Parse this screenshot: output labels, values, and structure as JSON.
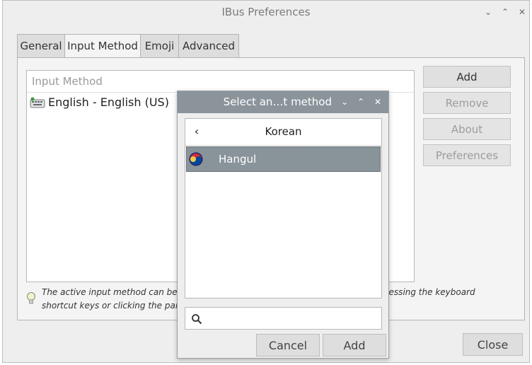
{
  "window": {
    "title": "IBus Preferences",
    "controls": {
      "minimize": "⌄",
      "maximize": "⌃",
      "close": "✕"
    }
  },
  "tabs": [
    {
      "label": "General",
      "active": false
    },
    {
      "label": "Input Method",
      "active": true
    },
    {
      "label": "Emoji",
      "active": false
    },
    {
      "label": "Advanced",
      "active": false
    }
  ],
  "input_method_list": {
    "header": "Input Method",
    "rows": [
      {
        "label": "English - English (US)",
        "icon": "keyboard-icon"
      }
    ]
  },
  "side_buttons": {
    "add": "Add",
    "remove": "Remove",
    "about": "About",
    "preferences": "Preferences"
  },
  "hint": {
    "text_line1": "The active input method can be swi",
    "text_line1_end": "pressing the keyboard",
    "text_line2": "shortcut keys or clicking the panel ic"
  },
  "close_button": "Close",
  "dialog": {
    "title": "Select an…t method",
    "language": "Korean",
    "selected_item": "Hangul",
    "search": {
      "value": "",
      "placeholder": ""
    },
    "cancel": "Cancel",
    "add": "Add"
  },
  "colors": {
    "dialog_titlebar": "#8b949b",
    "selected_row": "#88939a"
  }
}
